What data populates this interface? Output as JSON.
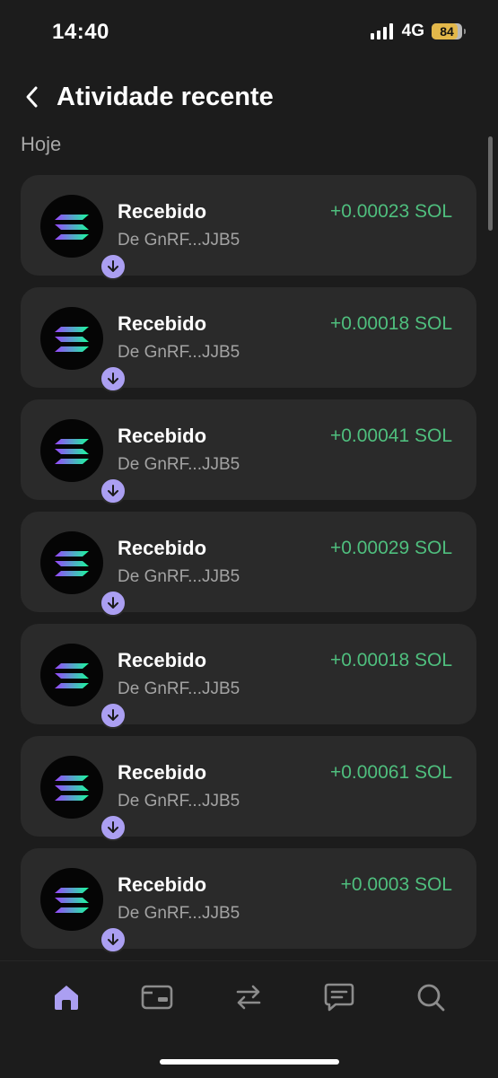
{
  "status": {
    "time": "14:40",
    "network": "4G",
    "battery": "84",
    "battery_level": 0.84
  },
  "header": {
    "title": "Atividade recente",
    "back_icon": "chevron-left-icon"
  },
  "section": {
    "label": "Hoje"
  },
  "transactions": [
    {
      "title": "Recebido",
      "subtitle": "De GnRF...JJB5",
      "amount": "+0.00023 SOL",
      "icon": "solana-icon",
      "badge_icon": "arrow-down-icon"
    },
    {
      "title": "Recebido",
      "subtitle": "De GnRF...JJB5",
      "amount": "+0.00018 SOL",
      "icon": "solana-icon",
      "badge_icon": "arrow-down-icon"
    },
    {
      "title": "Recebido",
      "subtitle": "De GnRF...JJB5",
      "amount": "+0.00041 SOL",
      "icon": "solana-icon",
      "badge_icon": "arrow-down-icon"
    },
    {
      "title": "Recebido",
      "subtitle": "De GnRF...JJB5",
      "amount": "+0.00029 SOL",
      "icon": "solana-icon",
      "badge_icon": "arrow-down-icon"
    },
    {
      "title": "Recebido",
      "subtitle": "De GnRF...JJB5",
      "amount": "+0.00018 SOL",
      "icon": "solana-icon",
      "badge_icon": "arrow-down-icon"
    },
    {
      "title": "Recebido",
      "subtitle": "De GnRF...JJB5",
      "amount": "+0.00061 SOL",
      "icon": "solana-icon",
      "badge_icon": "arrow-down-icon"
    },
    {
      "title": "Recebido",
      "subtitle": "De GnRF...JJB5",
      "amount": "+0.0003 SOL",
      "icon": "solana-icon",
      "badge_icon": "arrow-down-icon"
    }
  ],
  "tabs": [
    {
      "icon": "home-icon",
      "active": true
    },
    {
      "icon": "wallet-card-icon",
      "active": false
    },
    {
      "icon": "swap-icon",
      "active": false
    },
    {
      "icon": "chat-icon",
      "active": false
    },
    {
      "icon": "search-icon",
      "active": false
    }
  ],
  "colors": {
    "background": "#1c1c1c",
    "card": "#2a2a2a",
    "accent": "#ab9ff2",
    "positive": "#4fbf7e",
    "muted": "#a3a3a3",
    "inactive_icon": "#8c8c8c"
  }
}
